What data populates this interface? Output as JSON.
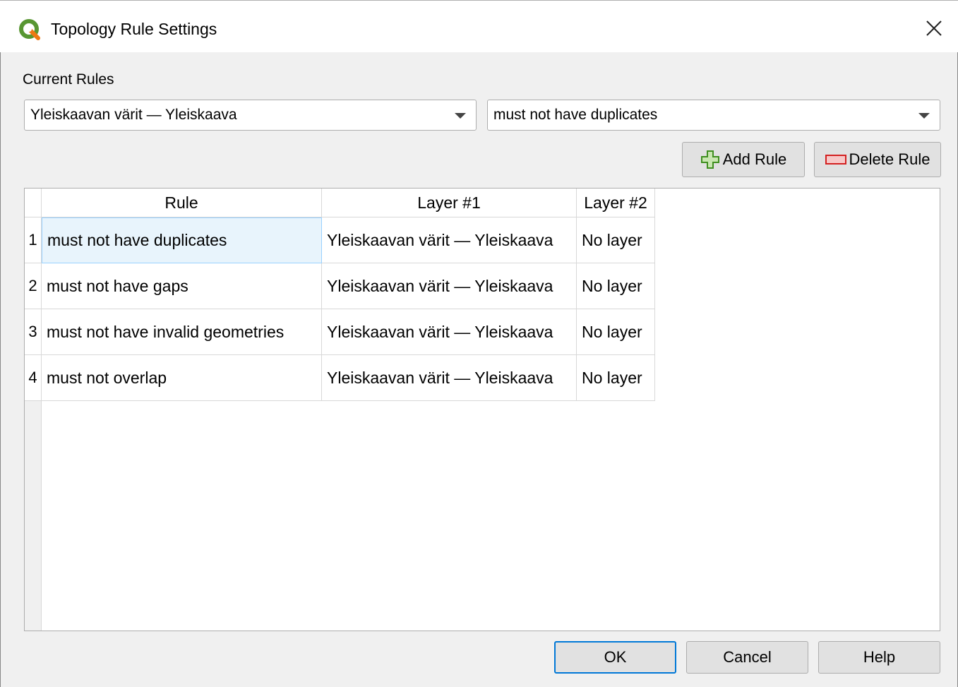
{
  "window": {
    "title": "Topology Rule Settings",
    "close_glyph": "✕",
    "accent": "#589632"
  },
  "current_rules_label": "Current Rules",
  "layer_combo": {
    "value": "Yleiskaavan värit — Yleiskaava"
  },
  "rule_combo": {
    "value": "must not have duplicates"
  },
  "buttons": {
    "add_rule": "Add Rule",
    "delete_rule": "Delete Rule",
    "ok": "OK",
    "cancel": "Cancel",
    "help": "Help"
  },
  "table": {
    "headers": [
      "Rule",
      "Layer #1",
      "Layer #2"
    ],
    "rows": [
      {
        "num": "1",
        "rule": "must not have duplicates",
        "layer1": "Yleiskaavan värit — Yleiskaava",
        "layer2": "No layer"
      },
      {
        "num": "2",
        "rule": "must not have gaps",
        "layer1": "Yleiskaavan värit — Yleiskaava",
        "layer2": "No layer"
      },
      {
        "num": "3",
        "rule": "must not have invalid geometries",
        "layer1": "Yleiskaavan värit — Yleiskaava",
        "layer2": "No layer"
      },
      {
        "num": "4",
        "rule": "must not overlap",
        "layer1": "Yleiskaavan värit — Yleiskaava",
        "layer2": "No layer"
      }
    ],
    "selected_row": 0
  }
}
